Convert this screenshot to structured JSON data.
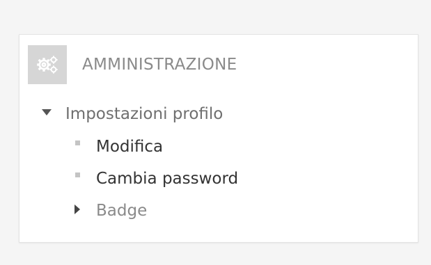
{
  "block": {
    "title": "AMMINISTRAZIONE",
    "icon": "gears-icon"
  },
  "tree": {
    "profile_settings": {
      "label": "Impostazioni profilo",
      "state": "expanded",
      "children": [
        {
          "label": "Modifica"
        },
        {
          "label": "Cambia password"
        },
        {
          "label": "Badge",
          "state": "collapsed"
        }
      ]
    }
  },
  "colors": {
    "icon_bg": "#d6d6d6",
    "title": "#8a8a8a",
    "link": "#333333"
  }
}
